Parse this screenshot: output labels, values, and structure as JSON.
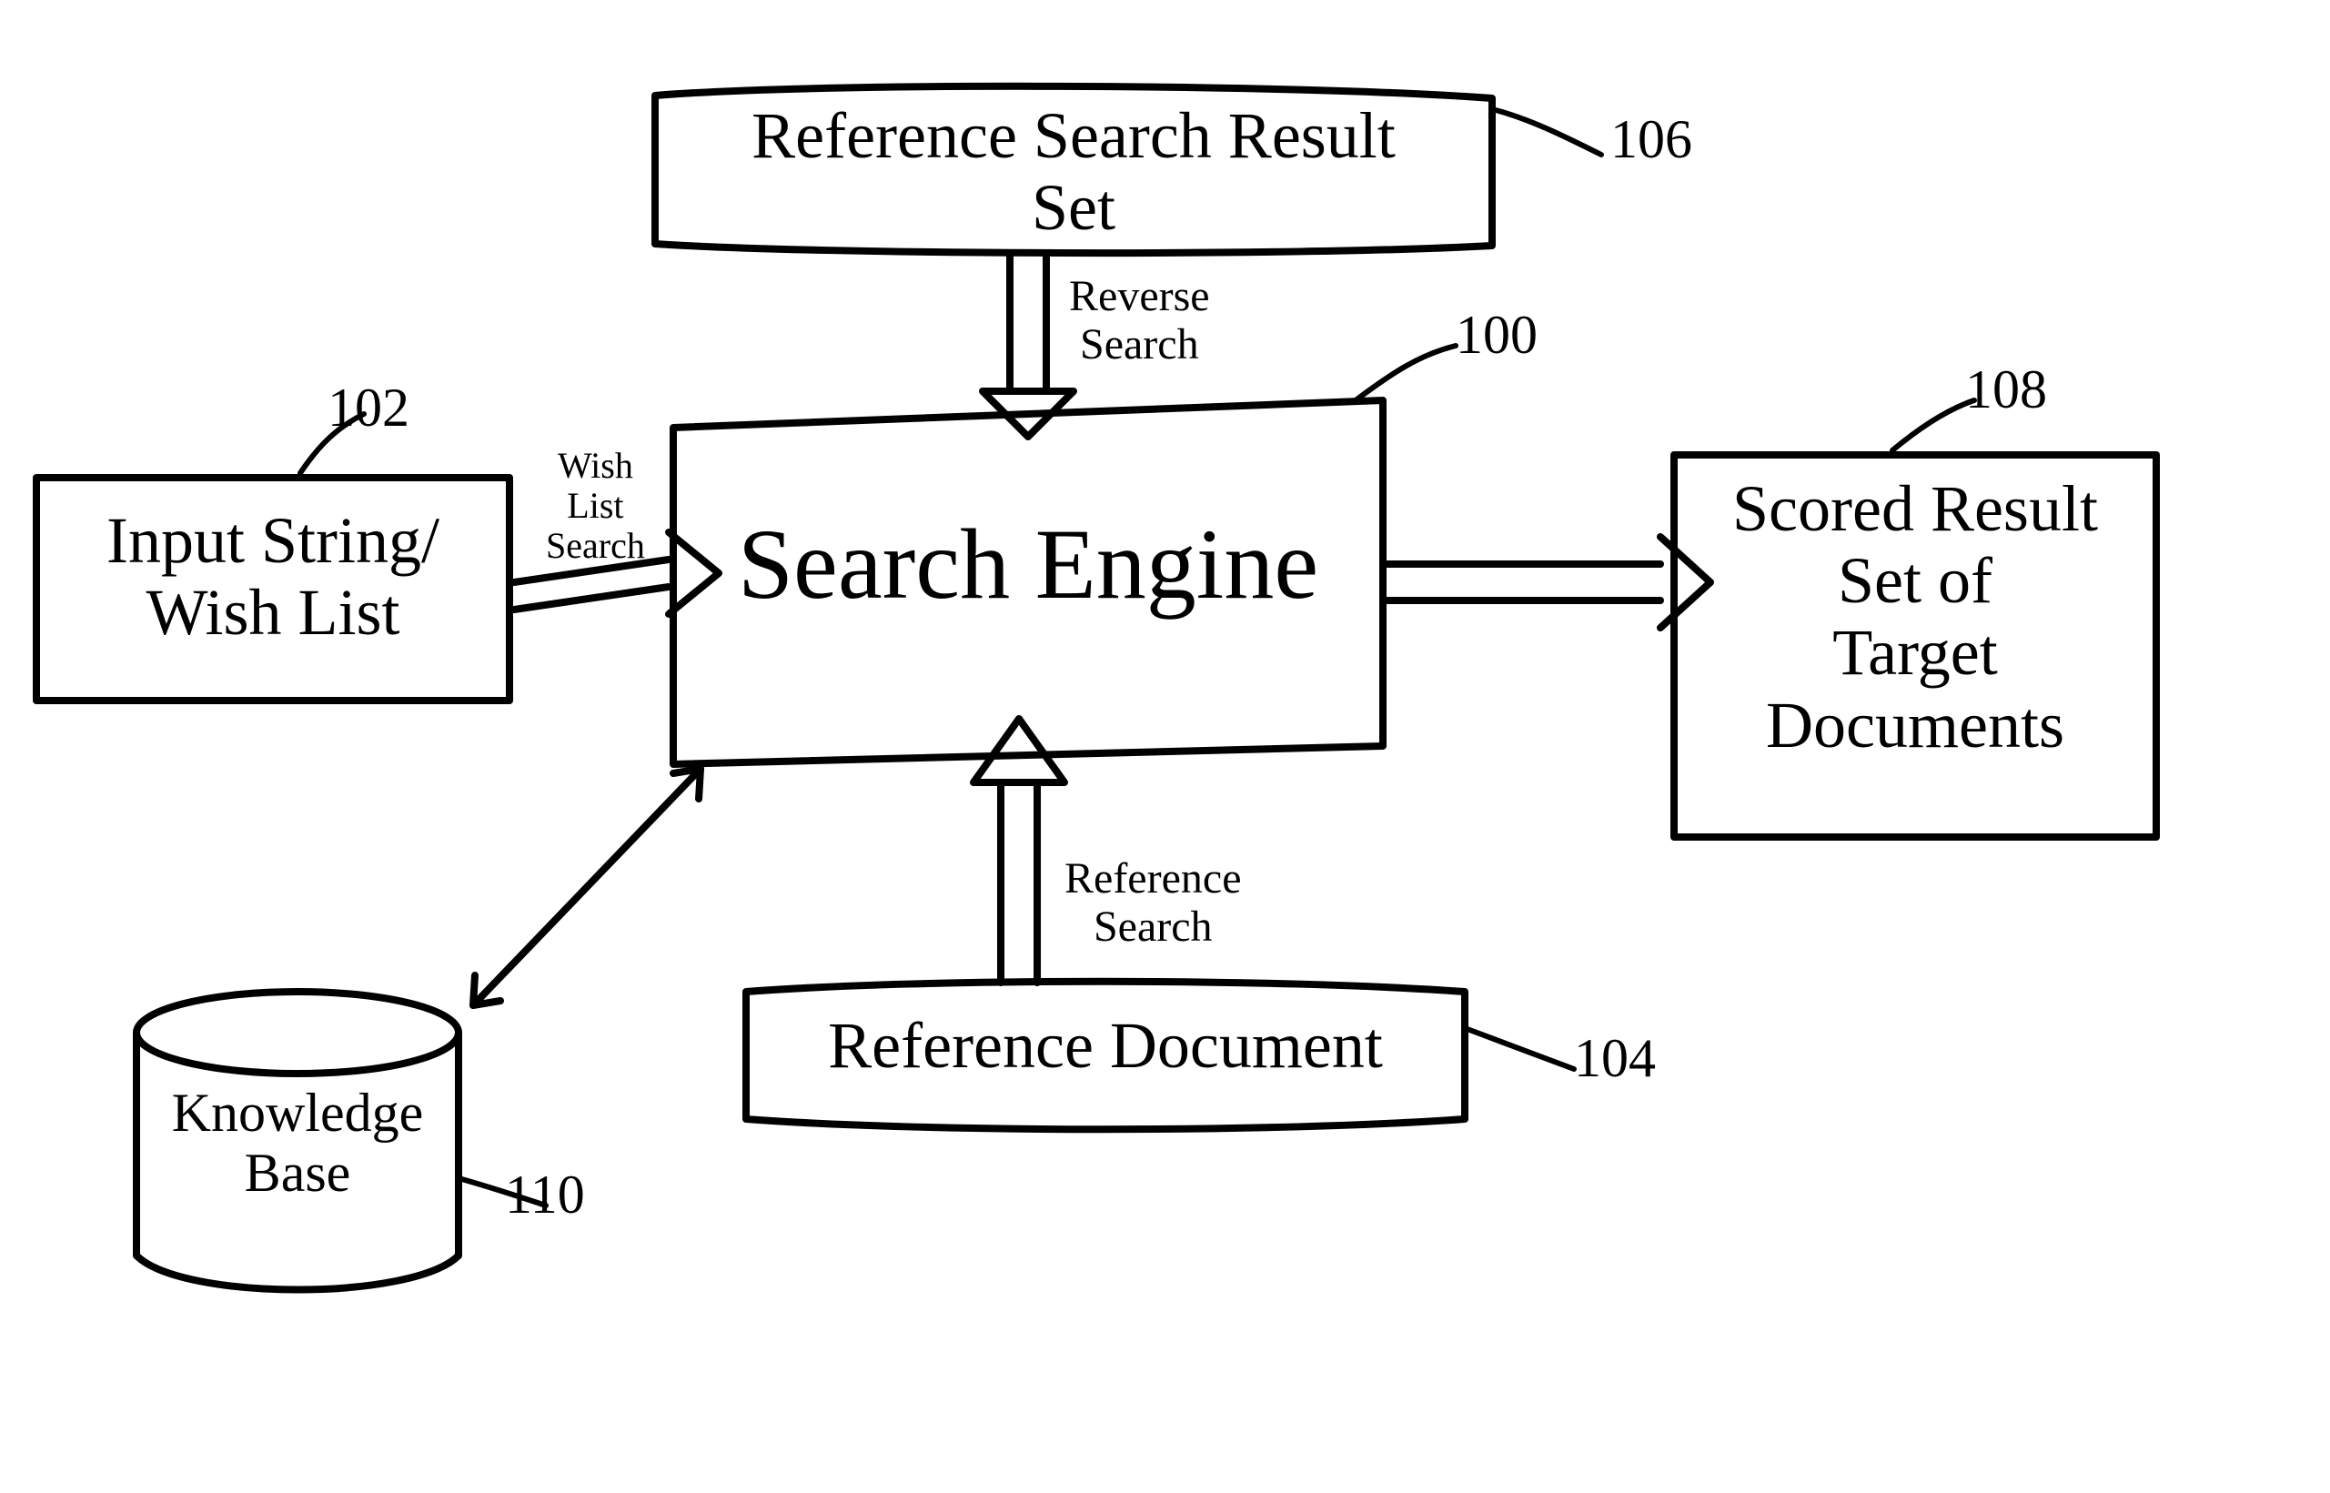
{
  "nodes": {
    "reference_search_result_set": {
      "label": "Reference Search Result\nSet",
      "ref": "106"
    },
    "input_string_wish_list": {
      "label": "Input String/\nWish List",
      "ref": "102"
    },
    "search_engine": {
      "label": "Search Engine",
      "ref": "100"
    },
    "scored_result_set": {
      "label": "Scored Result\nSet of\nTarget\nDocuments",
      "ref": "108"
    },
    "reference_document": {
      "label": "Reference Document",
      "ref": "104"
    },
    "knowledge_base": {
      "label": "Knowledge\nBase",
      "ref": "110"
    }
  },
  "edges": {
    "reverse_search": {
      "label": "Reverse\nSearch"
    },
    "wish_list_search": {
      "label": "Wish\nList\nSearch"
    },
    "reference_search": {
      "label": "Reference\nSearch"
    }
  }
}
